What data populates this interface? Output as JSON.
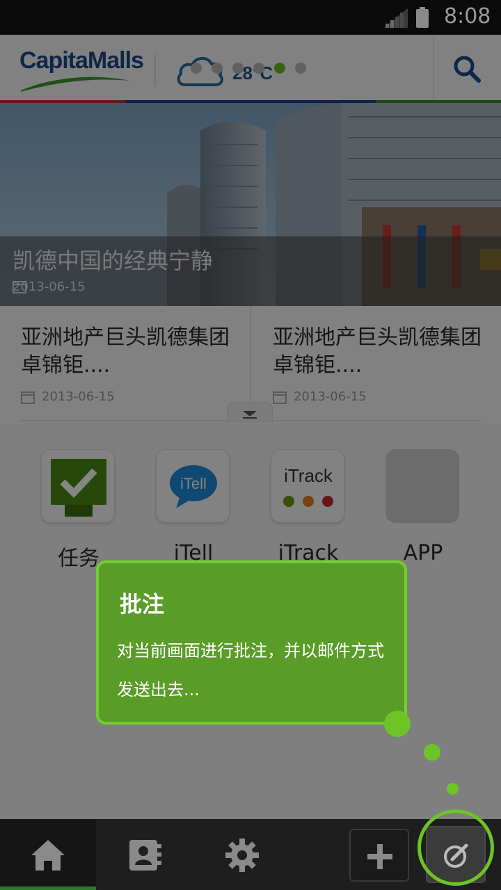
{
  "status_bar": {
    "time": "8:08"
  },
  "header": {
    "logo_text": "CapitaMalls",
    "temperature": "28°C",
    "page_dots": 6,
    "active_dot": 4
  },
  "hero": {
    "title": "凯德中国的经典宁静",
    "date": "2013-06-15"
  },
  "news": [
    {
      "title": "亚洲地产巨头凯德集团 卓锦钜....",
      "date": "2013-06-15"
    },
    {
      "title": "亚洲地产巨头凯德集团 卓锦钜....",
      "date": "2013-06-15"
    }
  ],
  "apps": [
    {
      "label": "任务",
      "icon": "task-check-icon"
    },
    {
      "label": "iTell",
      "icon": "itell-bubble-icon",
      "icon_text": "iTell"
    },
    {
      "label": "iTrack",
      "icon": "itrack-traffic-icon",
      "icon_text": "iTrack"
    },
    {
      "label": "APP",
      "icon": "blank-app-icon"
    }
  ],
  "tooltip": {
    "title": "批注",
    "body": "对当前画面进行批注，并以邮件方式发送出去..."
  },
  "bottom_nav": [
    {
      "name": "home",
      "icon": "home-icon"
    },
    {
      "name": "contacts",
      "icon": "contacts-icon"
    },
    {
      "name": "settings",
      "icon": "gear-icon"
    },
    {
      "name": "add",
      "icon": "plus-icon"
    },
    {
      "name": "annotate",
      "icon": "annotate-icon"
    }
  ],
  "colors": {
    "accent_green": "#6cc524",
    "tooltip_bg": "#5a9c28",
    "brand_blue": "#1b4a8a",
    "strip": [
      "#c8312b",
      "#1b3f8a",
      "#1b3f8a",
      "#3a8a2a"
    ]
  }
}
